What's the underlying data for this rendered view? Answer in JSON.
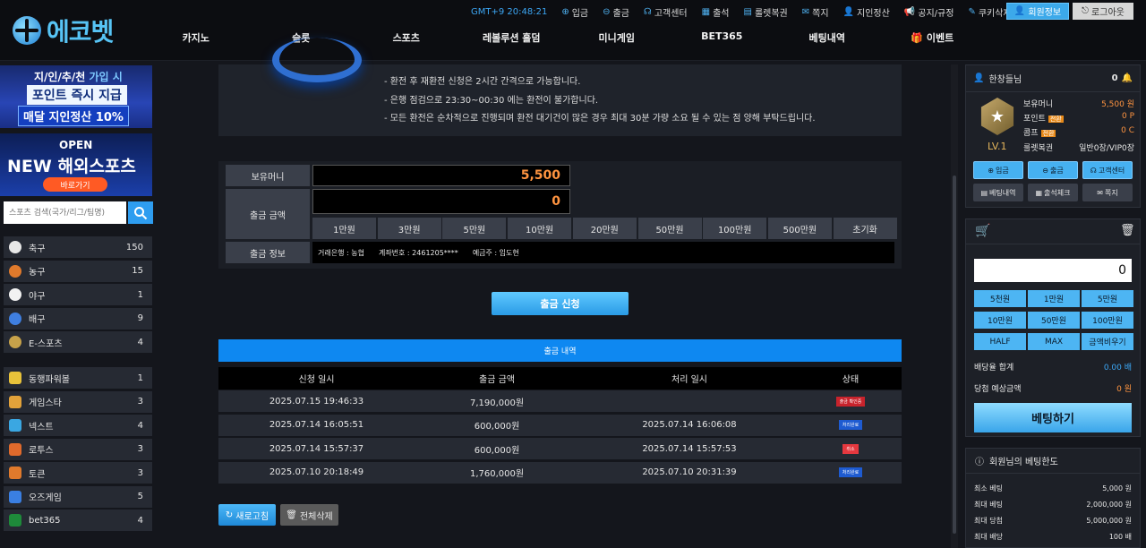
{
  "header": {
    "logo_text": "에코벳",
    "time": "GMT+9 20:48:21",
    "top_links": [
      {
        "icon": "deposit-icon",
        "glyph": "⊕",
        "label": "입금"
      },
      {
        "icon": "withdraw-icon",
        "glyph": "⊖",
        "label": "출금"
      },
      {
        "icon": "headset-icon",
        "glyph": "☊",
        "label": "고객센터"
      },
      {
        "icon": "calendar-icon",
        "glyph": "▦",
        "label": "출석"
      },
      {
        "icon": "ticket-icon",
        "glyph": "▤",
        "label": "룰렛복권"
      },
      {
        "icon": "mail-icon",
        "glyph": "✉",
        "label": "쪽지"
      },
      {
        "icon": "person-icon",
        "glyph": "👤",
        "label": "지인정산"
      },
      {
        "icon": "megaphone-icon",
        "glyph": "📢",
        "label": "공지/규정"
      },
      {
        "icon": "broom-icon",
        "glyph": "✎",
        "label": "쿠키삭제"
      }
    ],
    "member_info_label": "회원정보",
    "logout_label": "로그아웃",
    "nav": [
      "카지노",
      "슬롯",
      "스포츠",
      "레볼루션 홀덤",
      "미니게임",
      "BET365",
      "베팅내역",
      "이벤트"
    ]
  },
  "sidebar": {
    "banner1": {
      "line1_a": "지/인/추/천",
      "line1_b": "가입 시",
      "line2": "포인트 즉시 지급",
      "line3": "매달 지인정산 10%"
    },
    "banner2": {
      "line1": "OPEN",
      "line2_a": "NEW",
      "line2_b": "해외스포츠",
      "button": "바로가기"
    },
    "search_placeholder": "스포츠 검색(국가/리그/팀명)",
    "sports": [
      {
        "name": "축구",
        "count": "150",
        "color": "#e8e8e8"
      },
      {
        "name": "농구",
        "count": "15",
        "color": "#e07a2c"
      },
      {
        "name": "야구",
        "count": "1",
        "color": "#f2f2f2"
      },
      {
        "name": "배구",
        "count": "9",
        "color": "#3f7fe0"
      },
      {
        "name": "E-스포츠",
        "count": "4",
        "color": "#c7a24a"
      }
    ],
    "games": [
      {
        "name": "동행파워볼",
        "count": "1",
        "color": "#e8c23a"
      },
      {
        "name": "게임스타",
        "count": "3",
        "color": "#e2a23a"
      },
      {
        "name": "넥스트",
        "count": "4",
        "color": "#3aa7e2"
      },
      {
        "name": "로투스",
        "count": "3",
        "color": "#e06a2c"
      },
      {
        "name": "토큰",
        "count": "3",
        "color": "#e07a2c"
      },
      {
        "name": "오즈게임",
        "count": "5",
        "color": "#3a7fe2"
      },
      {
        "name": "bet365",
        "count": "4",
        "color": "#1e8a3a"
      }
    ]
  },
  "notice": {
    "lines": [
      "- 환전 후 재환전 신청은 2시간 간격으로 가능합니다.",
      "- 은행 점검으로 23:30~00:30 에는 환전이 불가합니다.",
      "- 모든 환전은 순차적으로 진행되며 환전 대기건이 많은 경우 최대 30분 가량 소요 될 수 있는 점 양해 부탁드립니다."
    ]
  },
  "form": {
    "balance_label": "보유머니",
    "balance_value": "5,500",
    "amount_label": "출금 금액",
    "amount_value": "0",
    "amount_buttons": [
      "1만원",
      "3만원",
      "5만원",
      "10만원",
      "20만원",
      "50만원",
      "100만원",
      "500만원",
      "초기화"
    ],
    "info_label": "출금 정보",
    "bank": "거래은행 : 농협",
    "account": "계좌번호 : 2461205****",
    "holder": "예금주 : 임도현",
    "submit_label": "출금 신청"
  },
  "history": {
    "title": "출금 내역",
    "columns": [
      "신청 일시",
      "출금 금액",
      "처리 일시",
      "상태"
    ],
    "rows": [
      {
        "requested": "2025.07.15 19:46:33",
        "amount": "7,190,000원",
        "processed": "",
        "status": "출금 확인중",
        "status_color": "#c8232c"
      },
      {
        "requested": "2025.07.14 16:05:51",
        "amount": "600,000원",
        "processed": "2025.07.14 16:06:08",
        "status": "처리완료",
        "status_color": "#1e5bd1"
      },
      {
        "requested": "2025.07.14 15:57:37",
        "amount": "600,000원",
        "processed": "2025.07.14 15:57:53",
        "status": "취소",
        "status_color": "#e5383f"
      },
      {
        "requested": "2025.07.10 20:18:49",
        "amount": "1,760,000원",
        "processed": "2025.07.10 20:31:39",
        "status": "처리완료",
        "status_color": "#1e5bd1"
      }
    ],
    "refresh_label": "새로고침",
    "delete_all_label": "전체삭제"
  },
  "user": {
    "name": "한창들님",
    "notification_count": "0",
    "level": "LV.1",
    "money_label": "보유머니",
    "money_value": "5,500 원",
    "point_label": "포인트",
    "point_tag": "전환",
    "point_value": "0 P",
    "comp_label": "콤프",
    "comp_tag": "전환",
    "comp_value": "0 C",
    "roulette_label": "룰렛복권",
    "roulette_value": "일반0장/VIP0장",
    "buttons": [
      {
        "icon": "deposit-icon",
        "glyph": "⊕",
        "label": "입금",
        "style": "blue"
      },
      {
        "icon": "withdraw-icon",
        "glyph": "⊖",
        "label": "출금",
        "style": "blue"
      },
      {
        "icon": "headset-icon",
        "glyph": "☊",
        "label": "고객센터",
        "style": "blue"
      },
      {
        "icon": "list-icon",
        "glyph": "▤",
        "label": "베팅내역",
        "style": "gray"
      },
      {
        "icon": "calendar-icon",
        "glyph": "▦",
        "label": "출석체크",
        "style": "gray"
      },
      {
        "icon": "mail-icon",
        "glyph": "✉",
        "label": "쪽지",
        "style": "gray"
      }
    ]
  },
  "betslip": {
    "value": "0",
    "chips": [
      "5천원",
      "1만원",
      "5만원",
      "10만원",
      "50만원",
      "100만원",
      "HALF",
      "MAX",
      "금액비우기"
    ],
    "odds_label": "배당율 합계",
    "odds_value": "0.00 배",
    "expected_label": "당첨 예상금액",
    "expected_value": "0 원",
    "bet_button": "베팅하기"
  },
  "limits": {
    "title": "회원님의 베팅한도",
    "rows": [
      {
        "label": "최소 베팅",
        "value": "5,000 원"
      },
      {
        "label": "최대 베팅",
        "value": "2,000,000 원"
      },
      {
        "label": "최대 당첨",
        "value": "5,000,000 원"
      },
      {
        "label": "최대 배당",
        "value": "100 배"
      }
    ]
  }
}
